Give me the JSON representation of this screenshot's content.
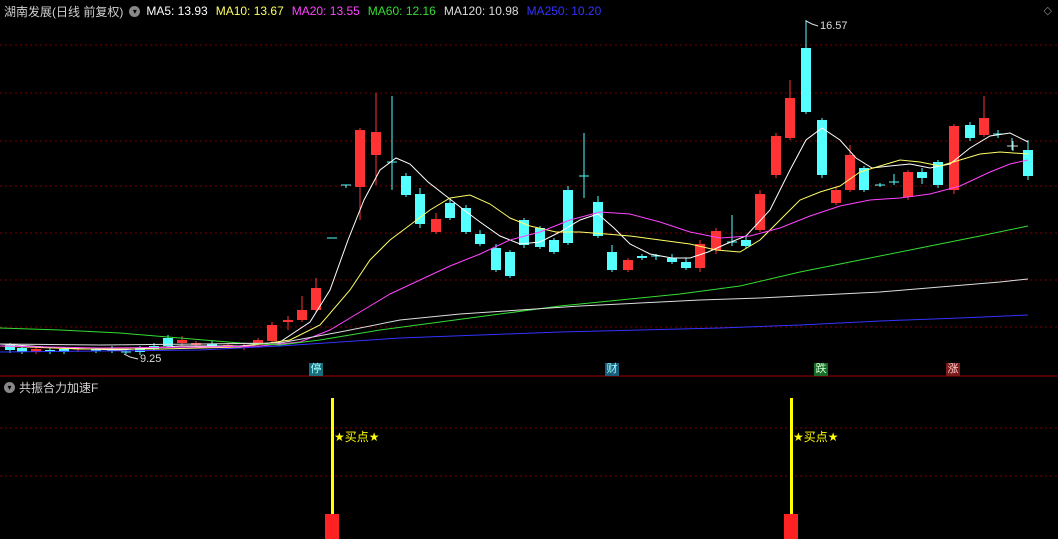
{
  "legend": {
    "title": "湖南发展(日线 前复权)",
    "ma": [
      {
        "label": "MA5: 13.93",
        "color": "#ffffff"
      },
      {
        "label": "MA10: 13.67",
        "color": "#ffff66"
      },
      {
        "label": "MA20: 13.55",
        "color": "#ff44ff"
      },
      {
        "label": "MA60: 12.16",
        "color": "#33dd33"
      },
      {
        "label": "MA120: 10.98",
        "color": "#dddddd"
      },
      {
        "label": "MA250: 10.20",
        "color": "#3333ff"
      }
    ]
  },
  "price_labels": {
    "high": "16.57",
    "low": "9.25"
  },
  "event_tags": [
    {
      "text": "停",
      "bg": "#1b6c7a",
      "color": "#9ff"
    },
    {
      "text": "财",
      "bg": "#1b5c7a",
      "color": "#9ff"
    },
    {
      "text": "跌",
      "bg": "#1a6a2a",
      "color": "#cfc"
    },
    {
      "text": "涨",
      "bg": "#7a1b1b",
      "color": "#fcc"
    }
  ],
  "indicator": {
    "title": "共振合力加速F",
    "signal_label": "★买点★",
    "signals": 2
  },
  "colors": {
    "up": "#ff3333",
    "down": "#55ffff",
    "grid": "#7a0000"
  }
}
